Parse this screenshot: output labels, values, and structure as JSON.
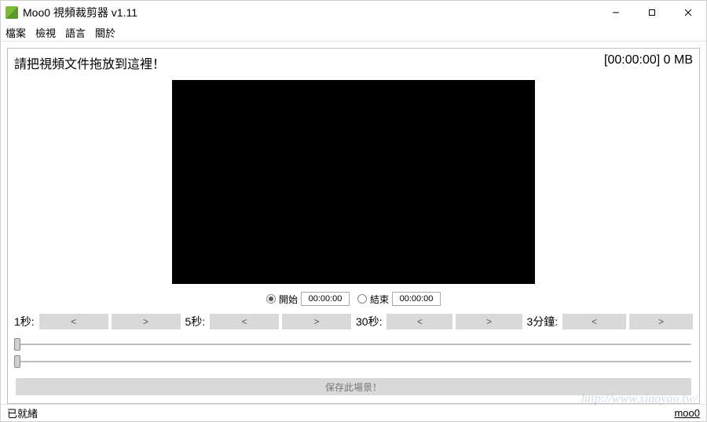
{
  "window": {
    "title": "Moo0 視頻裁剪器 v1.11"
  },
  "menu": {
    "file": "檔案",
    "view": "檢視",
    "language": "語言",
    "about": "關於"
  },
  "panel": {
    "drop_hint": "請把視頻文件拖放到這裡！",
    "duration_size": "[00:00:00]  0 MB"
  },
  "time": {
    "start_label": "開始",
    "start_value": "00:00:00",
    "end_label": "結束",
    "end_value": "00:00:00"
  },
  "steps": {
    "s1": {
      "label": "1秒:",
      "back": "<",
      "fwd": ">"
    },
    "s5": {
      "label": "5秒:",
      "back": "<",
      "fwd": ">"
    },
    "s30": {
      "label": "30秒:",
      "back": "<",
      "fwd": ">"
    },
    "m3": {
      "label": "3分鐘:",
      "back": "<",
      "fwd": ">"
    }
  },
  "save_button": "保存此場景！",
  "status": {
    "text": "已就緒",
    "link": "moo0"
  },
  "watermark": "http://www.xiaoyao.tw/"
}
